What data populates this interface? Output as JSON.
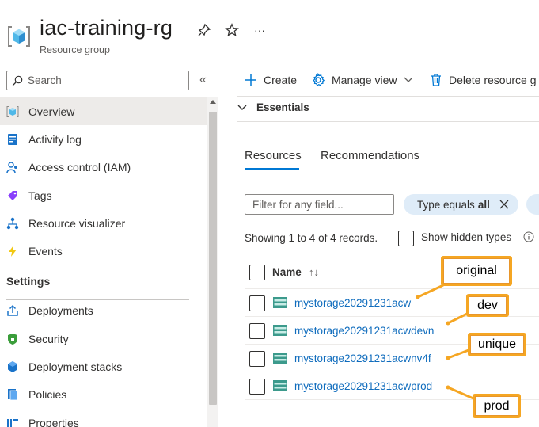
{
  "header": {
    "title": "iac-training-rg",
    "subtitle": "Resource group",
    "more_label": "···"
  },
  "sidebar": {
    "search_placeholder": "Search",
    "collapse_label": "«",
    "items": [
      {
        "label": "Overview",
        "icon": "overview-icon",
        "active": true
      },
      {
        "label": "Activity log",
        "icon": "activity-log-icon"
      },
      {
        "label": "Access control (IAM)",
        "icon": "people-icon"
      },
      {
        "label": "Tags",
        "icon": "tag-icon"
      },
      {
        "label": "Resource visualizer",
        "icon": "visualizer-icon"
      },
      {
        "label": "Events",
        "icon": "lightning-icon"
      }
    ],
    "section_settings": "Settings",
    "settings_items": [
      {
        "label": "Deployments",
        "icon": "deployments-icon"
      },
      {
        "label": "Security",
        "icon": "shield-icon"
      },
      {
        "label": "Deployment stacks",
        "icon": "stacks-icon"
      },
      {
        "label": "Policies",
        "icon": "policies-icon"
      },
      {
        "label": "Properties",
        "icon": "properties-icon"
      }
    ]
  },
  "toolbar": {
    "create_label": "Create",
    "manage_view_label": "Manage view",
    "delete_label": "Delete resource g"
  },
  "essentials": {
    "label": "Essentials"
  },
  "tabs": [
    {
      "label": "Resources",
      "active": true
    },
    {
      "label": "Recommendations"
    }
  ],
  "filter": {
    "placeholder": "Filter for any field...",
    "pill_prefix": "Type equals",
    "pill_value": "all"
  },
  "records": {
    "text": "Showing 1 to 4 of 4 records.",
    "show_hidden_label": "Show hidden types"
  },
  "table": {
    "column_name": "Name",
    "sort_indicator": "↑↓",
    "rows": [
      {
        "name": "mystorage20291231acw"
      },
      {
        "name": "mystorage20291231acwdevn"
      },
      {
        "name": "mystorage20291231acwnv4f"
      },
      {
        "name": "mystorage20291231acwprod"
      }
    ]
  },
  "callouts": {
    "original": "original",
    "dev": "dev",
    "unique": "unique",
    "prod": "prod"
  },
  "colors": {
    "accent": "#0078d4",
    "link": "#0f6cbd",
    "callout_border": "#f5a623",
    "active_nav": "#edebe9",
    "pill_bg": "#dfecf8"
  }
}
